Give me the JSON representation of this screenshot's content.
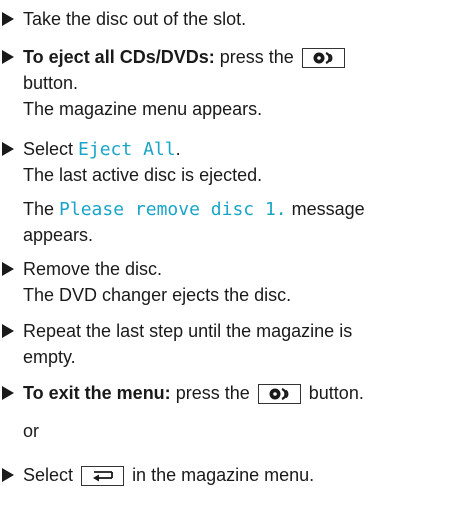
{
  "steps": [
    {
      "lines": [
        "Take the disc out of the slot."
      ]
    },
    {
      "bold_prefix": "To eject all CDs/DVDs:",
      "text_before_button": "press the",
      "button_icon": "disc-eject-icon",
      "line2": "button.",
      "line3": "The magazine menu appears."
    },
    {
      "select_label": "Select",
      "menu_item": "Eject All",
      "period": ".",
      "line2": "The last active disc is ejected.",
      "msg_prefix": "The",
      "message": "Please remove disc 1.",
      "msg_suffix": "message",
      "line4": "appears."
    },
    {
      "line1": "Remove the disc.",
      "line2": "The DVD changer ejects the disc."
    },
    {
      "line1": "Repeat the last step until the magazine is",
      "line2": "empty."
    },
    {
      "bold_prefix": "To exit the menu:",
      "text_before_button": "press the",
      "button_icon": "disc-eject-icon",
      "text_after_button": "button."
    },
    {
      "or": "or"
    },
    {
      "select_label": "Select",
      "button_icon": "back-arrow-icon",
      "text_after_button": "in the magazine menu."
    }
  ],
  "colors": {
    "display_text": "#1aa5c8",
    "body_text": "#1a1a1a"
  }
}
